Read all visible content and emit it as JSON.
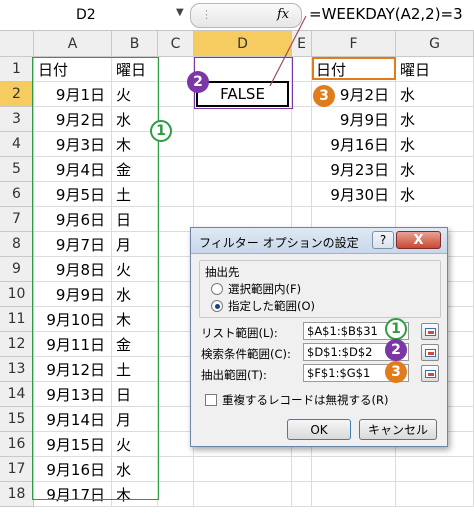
{
  "name_box": "D2",
  "formula": "=WEEKDAY(A2,2)=3",
  "columns": [
    "A",
    "B",
    "C",
    "D",
    "E",
    "F",
    "G"
  ],
  "rows": [
    "1",
    "2",
    "3",
    "4",
    "5",
    "6",
    "7",
    "8",
    "9",
    "10",
    "11",
    "12",
    "13",
    "14",
    "15",
    "16",
    "17",
    "18"
  ],
  "col_a": [
    "日付",
    "9月1日",
    "9月2日",
    "9月3日",
    "9月4日",
    "9月5日",
    "9月6日",
    "9月7日",
    "9月8日",
    "9月9日",
    "9月10日",
    "9月11日",
    "9月12日",
    "9月13日",
    "9月14日",
    "9月15日",
    "9月16日",
    "9月17日"
  ],
  "col_b": [
    "曜日",
    "火",
    "水",
    "木",
    "金",
    "土",
    "日",
    "月",
    "火",
    "水",
    "木",
    "金",
    "土",
    "日",
    "月",
    "火",
    "水",
    "木"
  ],
  "d2": "FALSE",
  "col_f": [
    "日付",
    "9月2日",
    "9月9日",
    "9月16日",
    "9月23日",
    "9月30日"
  ],
  "col_g": [
    "曜日",
    "水",
    "水",
    "水",
    "水",
    "水"
  ],
  "badges": {
    "one": "1",
    "two": "2",
    "three": "3"
  },
  "dialog": {
    "title": "フィルター オプションの設定",
    "help": "?",
    "close": "X",
    "group_label": "抽出先",
    "radio1": "選択範囲内(F)",
    "radio2": "指定した範囲(O)",
    "list_label": "リスト範囲(L):",
    "list_value": "$A$1:$B$31",
    "criteria_label": "検索条件範囲(C):",
    "criteria_value": "$D$1:$D$2",
    "extract_label": "抽出範囲(T):",
    "extract_value": "$F$1:$G$1",
    "unique_label": "重複するレコードは無視する(R)",
    "ok": "OK",
    "cancel": "キャンセル"
  },
  "colors": {
    "green": "#2e9c43",
    "purple": "#7a37a5",
    "orange": "#e07c1c",
    "selected_header": "#f6cc60"
  }
}
